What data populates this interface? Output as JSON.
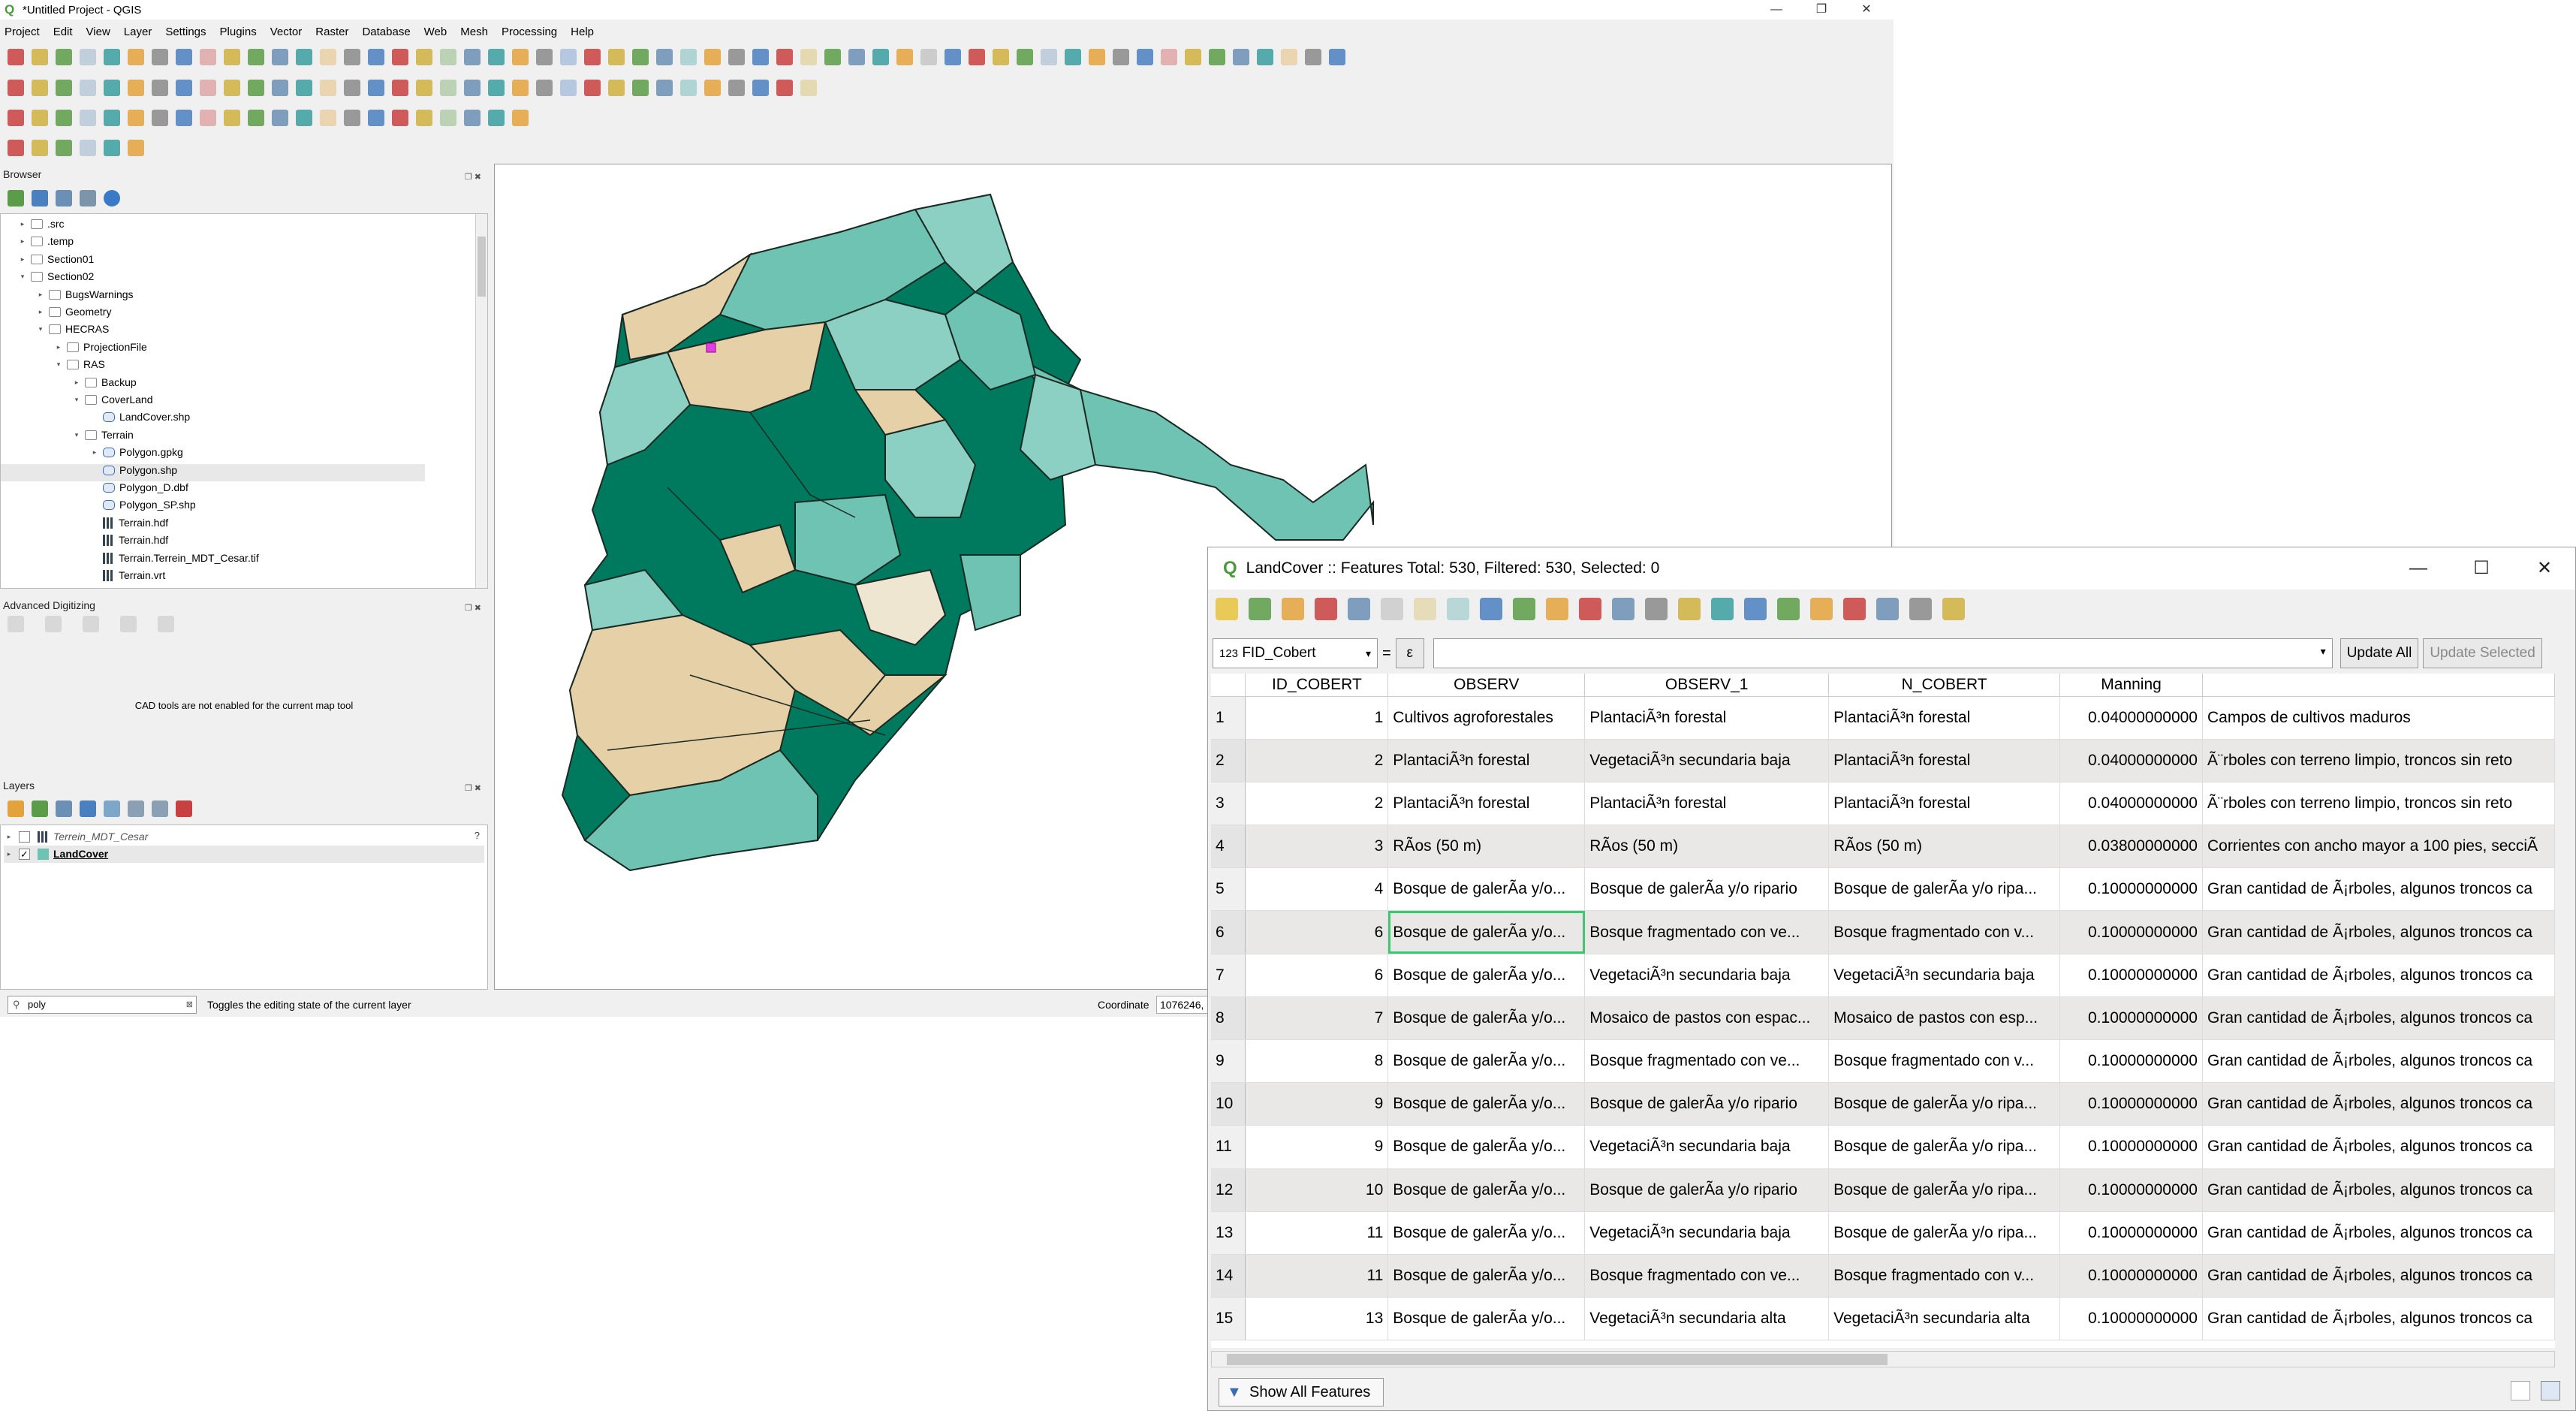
{
  "window": {
    "title": "*Untitled Project - QGIS",
    "min": "—",
    "max": "❐",
    "close": "✕"
  },
  "menu": [
    "Project",
    "Edit",
    "View",
    "Layer",
    "Settings",
    "Plugins",
    "Vector",
    "Raster",
    "Database",
    "Web",
    "Mesh",
    "Processing",
    "Help"
  ],
  "browser": {
    "title": "Browser",
    "items": [
      {
        "label": ".src",
        "level": 2,
        "icon": "folder",
        "arrow": "▸"
      },
      {
        "label": ".temp",
        "level": 2,
        "icon": "folder",
        "arrow": "▸"
      },
      {
        "label": "Section01",
        "level": 2,
        "icon": "folder",
        "arrow": "▸"
      },
      {
        "label": "Section02",
        "level": 2,
        "icon": "folder",
        "arrow": "▾"
      },
      {
        "label": "BugsWarnings",
        "level": 3,
        "icon": "folder",
        "arrow": "▸"
      },
      {
        "label": "Geometry",
        "level": 3,
        "icon": "folder",
        "arrow": "▸"
      },
      {
        "label": "HECRAS",
        "level": 3,
        "icon": "folder",
        "arrow": "▾"
      },
      {
        "label": "ProjectionFile",
        "level": 4,
        "icon": "folder",
        "arrow": "▸"
      },
      {
        "label": "RAS",
        "level": 4,
        "icon": "folder",
        "arrow": "▾"
      },
      {
        "label": "Backup",
        "level": 5,
        "icon": "folder",
        "arrow": "▸"
      },
      {
        "label": "CoverLand",
        "level": 5,
        "icon": "folder",
        "arrow": "▾"
      },
      {
        "label": "LandCover.shp",
        "level": 6,
        "icon": "shp",
        "arrow": ""
      },
      {
        "label": "Terrain",
        "level": 5,
        "icon": "folder",
        "arrow": "▾"
      },
      {
        "label": "Polygon.gpkg",
        "level": 6,
        "icon": "shp",
        "arrow": "▸"
      },
      {
        "label": "Polygon.shp",
        "level": 6,
        "icon": "shp",
        "arrow": ""
      },
      {
        "label": "Polygon_D.dbf",
        "level": 6,
        "icon": "shp",
        "arrow": ""
      },
      {
        "label": "Polygon_SP.shp",
        "level": 6,
        "icon": "shp",
        "arrow": ""
      },
      {
        "label": "Terrain.hdf",
        "level": 6,
        "icon": "raster",
        "arrow": ""
      },
      {
        "label": "Terrain.hdf",
        "level": 6,
        "icon": "raster",
        "arrow": ""
      },
      {
        "label": "Terrain.Terrein_MDT_Cesar.tif",
        "level": 6,
        "icon": "raster",
        "arrow": ""
      },
      {
        "label": "Terrain.vrt",
        "level": 6,
        "icon": "raster",
        "arrow": ""
      }
    ]
  },
  "advanced_digitizing": {
    "title": "Advanced Digitizing",
    "message": "CAD tools are not enabled for the current map tool"
  },
  "layers": {
    "title": "Layers",
    "items": [
      {
        "label": "Terrein_MDT_Cesar",
        "checked": false
      },
      {
        "label": "LandCover",
        "checked": true
      }
    ]
  },
  "status": {
    "search_value": "poly",
    "hint": "Toggles the editing state of the current layer",
    "coord_label": "Coordinate",
    "coord_value": "1076246,"
  },
  "attr": {
    "title": "LandCover :: Features Total: 530, Filtered: 530, Selected: 0",
    "field": "FID_Cobert",
    "field_prefix": "123",
    "eq": "=",
    "epsilon": "ε",
    "update_all": "Update All",
    "update_selected": "Update Selected",
    "show_all": "Show All Features",
    "columns": [
      "ID_COBERT",
      "OBSERV",
      "OBSERV_1",
      "N_COBERT",
      "Manning",
      ""
    ],
    "rows": [
      [
        "1",
        "1",
        "Cultivos agroforestales",
        "PlantaciÃ³n forestal",
        "PlantaciÃ³n forestal",
        "0.04000000000",
        "Campos de cultivos maduros"
      ],
      [
        "2",
        "2",
        "PlantaciÃ³n forestal",
        "VegetaciÃ³n secundaria baja",
        "PlantaciÃ³n forestal",
        "0.04000000000",
        "Ã¨rboles con terreno limpio, troncos sin reto"
      ],
      [
        "3",
        "2",
        "PlantaciÃ³n forestal",
        "PlantaciÃ³n forestal",
        "PlantaciÃ³n forestal",
        "0.04000000000",
        "Ã¨rboles con terreno limpio, troncos sin reto"
      ],
      [
        "4",
        "3",
        "RÃos (50 m)",
        "RÃos (50 m)",
        "RÃos (50 m)",
        "0.03800000000",
        "Corrientes con ancho mayor a 100 pies, secciÃ"
      ],
      [
        "5",
        "4",
        "Bosque de galerÃa y/o...",
        "Bosque de galerÃa y/o ripario",
        "Bosque de galerÃa y/o ripa...",
        "0.10000000000",
        "Gran cantidad de Ã¡rboles, algunos troncos ca"
      ],
      [
        "6",
        "6",
        "Bosque de galerÃa y/o...",
        "Bosque fragmentado con ve...",
        "Bosque fragmentado con v...",
        "0.10000000000",
        "Gran cantidad de Ã¡rboles, algunos troncos ca"
      ],
      [
        "7",
        "6",
        "Bosque de galerÃa y/o...",
        "VegetaciÃ³n secundaria baja",
        "VegetaciÃ³n secundaria baja",
        "0.10000000000",
        "Gran cantidad de Ã¡rboles, algunos troncos ca"
      ],
      [
        "8",
        "7",
        "Bosque de galerÃa y/o...",
        "Mosaico de pastos con espac...",
        "Mosaico de pastos con esp...",
        "0.10000000000",
        "Gran cantidad de Ã¡rboles, algunos troncos ca"
      ],
      [
        "9",
        "8",
        "Bosque de galerÃa y/o...",
        "Bosque fragmentado con ve...",
        "Bosque fragmentado con v...",
        "0.10000000000",
        "Gran cantidad de Ã¡rboles, algunos troncos ca"
      ],
      [
        "10",
        "9",
        "Bosque de galerÃa y/o...",
        "Bosque de galerÃa y/o ripario",
        "Bosque de galerÃa y/o ripa...",
        "0.10000000000",
        "Gran cantidad de Ã¡rboles, algunos troncos ca"
      ],
      [
        "11",
        "9",
        "Bosque de galerÃa y/o...",
        "VegetaciÃ³n secundaria baja",
        "Bosque de galerÃa y/o ripa...",
        "0.10000000000",
        "Gran cantidad de Ã¡rboles, algunos troncos ca"
      ],
      [
        "12",
        "10",
        "Bosque de galerÃa y/o...",
        "Bosque de galerÃa y/o ripario",
        "Bosque de galerÃa y/o ripa...",
        "0.10000000000",
        "Gran cantidad de Ã¡rboles, algunos troncos ca"
      ],
      [
        "13",
        "11",
        "Bosque de galerÃa y/o...",
        "VegetaciÃ³n secundaria baja",
        "Bosque de galerÃa y/o ripa...",
        "0.10000000000",
        "Gran cantidad de Ã¡rboles, algunos troncos ca"
      ],
      [
        "14",
        "11",
        "Bosque de galerÃa y/o...",
        "Bosque fragmentado con ve...",
        "Bosque fragmentado con v...",
        "0.10000000000",
        "Gran cantidad de Ã¡rboles, algunos troncos ca"
      ],
      [
        "15",
        "13",
        "Bosque de galerÃa y/o...",
        "VegetaciÃ³n secundaria alta",
        "VegetaciÃ³n secundaria alta",
        "0.10000000000",
        "Gran cantidad de Ã¡rboles, algunos troncos ca"
      ]
    ]
  },
  "map_colors": {
    "dark": "#007a5e",
    "mid": "#6fc3b3",
    "light": "#8bd0c2",
    "tan": "#e6d0a8",
    "cream": "#efe6d2"
  }
}
